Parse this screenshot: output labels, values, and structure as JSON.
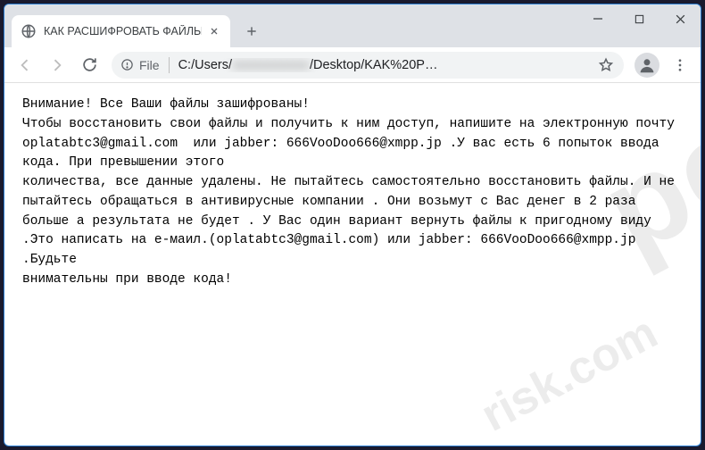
{
  "tab": {
    "title": "КАК РАСШИФРОВАТЬ ФАЙЛЫ.t"
  },
  "omnibox": {
    "scheme_label": "File",
    "url_prefix": "C:/Users/",
    "url_redacted": "xxxxxxxxxxxx",
    "url_suffix": "/Desktop/KAK%20P…"
  },
  "document": {
    "text": "Внимание! Все Ваши файлы зашифрованы!\nЧтобы восстановить свои файлы и получить к ним доступ, напишите на электронную почту oplatabtc3@gmail.com  или jabber: 666VooDoo666@xmpp.jp .У вас есть 6 попыток ввода кода. При превышении этого\nколичества, все данные удалены. Не пытайтесь самостоятельно восстановить файлы. И не пытайтесь обращаться в антивирусные компании . Они возьмут с Вас денег в 2 раза больше а результата не будет . У Вас один вариант вернуть файлы к пригодному виду .Это написать на е-маил.(oplatabtc3@gmail.com) или jabber: 666VooDoo666@xmpp.jp .Будьте\nвнимательны при вводе кода!"
  },
  "watermark": {
    "big": "pc",
    "small": "risk.com"
  }
}
